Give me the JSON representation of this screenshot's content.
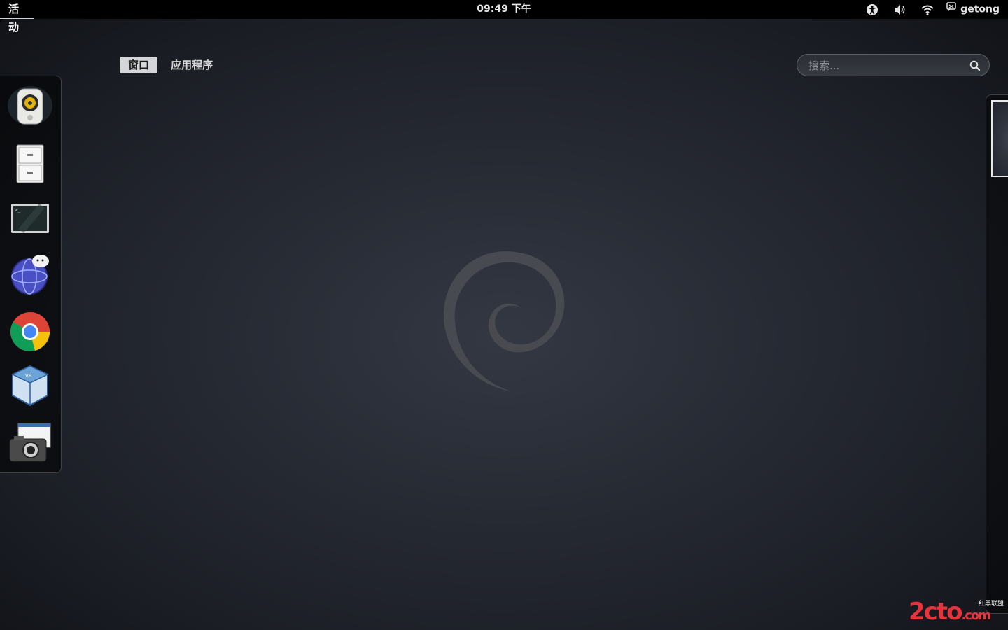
{
  "topbar": {
    "activities_label": "活动",
    "clock": "09:49 下午",
    "user_name": "getong"
  },
  "tray_icons": [
    "accessibility-icon",
    "volume-icon",
    "wifi-icon",
    "chat-status-icon"
  ],
  "overview": {
    "tabs": [
      {
        "label": "窗口",
        "active": true
      },
      {
        "label": "应用程序",
        "active": false
      }
    ],
    "search_placeholder": "搜索..."
  },
  "dash": {
    "apps": [
      "rhythmbox-speaker-icon",
      "file-manager-cabinet-icon",
      "terminal-icon",
      "iceweasel-browser-icon",
      "chrome-icon",
      "virtualbox-icon",
      "screenshot-camera-icon"
    ]
  },
  "watermark": {
    "text": "2cto",
    "suffix": ".com",
    "subtext": "红黑联盟"
  }
}
